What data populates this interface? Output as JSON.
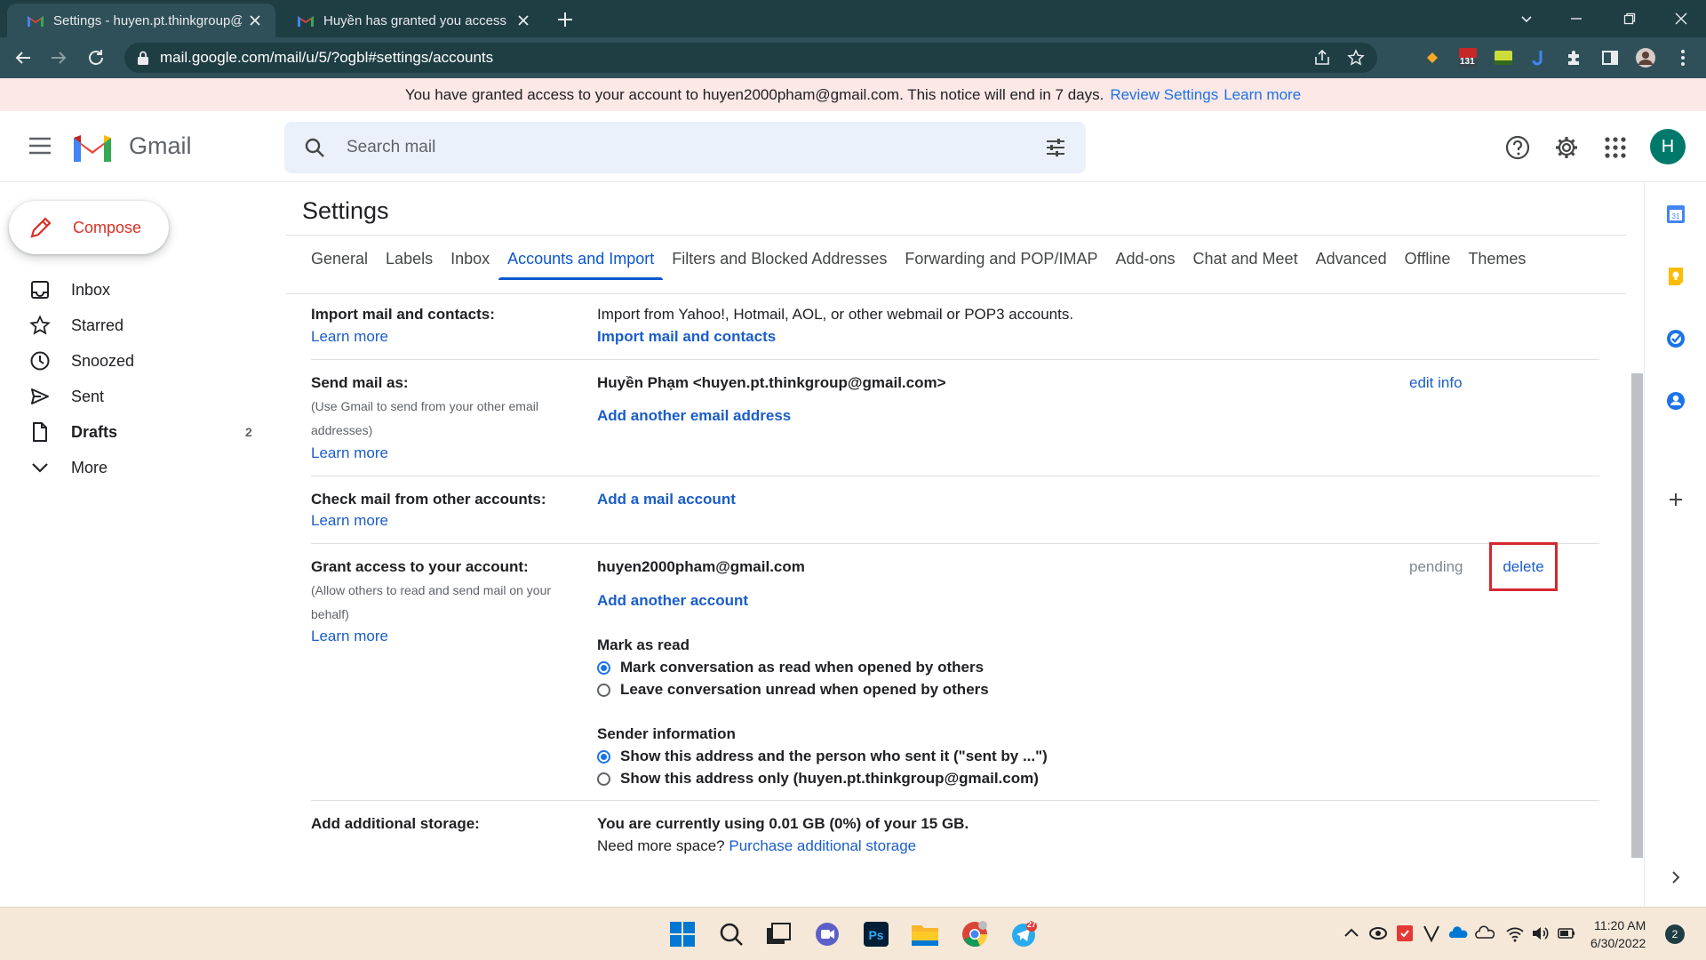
{
  "browser": {
    "tabs": [
      {
        "title": "Settings - huyen.pt.thinkgroup@gmail.com - Gmail"
      },
      {
        "title": "Huyền has granted you access to their account"
      }
    ],
    "url": "mail.google.com/mail/u/5/?ogbl#settings/accounts",
    "ext_badge": "131"
  },
  "notice": {
    "text": "You have granted access to your account to huyen2000pham@gmail.com. This notice will end in 7 days.",
    "review": "Review Settings",
    "learn": "Learn more"
  },
  "gmail": {
    "logo_text": "Gmail",
    "search_placeholder": "Search mail",
    "avatar": "H"
  },
  "nav": {
    "compose": "Compose",
    "items": [
      {
        "label": "Inbox",
        "count": ""
      },
      {
        "label": "Starred",
        "count": ""
      },
      {
        "label": "Snoozed",
        "count": ""
      },
      {
        "label": "Sent",
        "count": ""
      },
      {
        "label": "Drafts",
        "count": "2"
      },
      {
        "label": "More",
        "count": ""
      }
    ]
  },
  "settings": {
    "title": "Settings",
    "tabs": [
      "General",
      "Labels",
      "Inbox",
      "Accounts and Import",
      "Filters and Blocked Addresses",
      "Forwarding and POP/IMAP",
      "Add-ons",
      "Chat and Meet",
      "Advanced",
      "Offline",
      "Themes"
    ],
    "import": {
      "label": "Import mail and contacts:",
      "learn": "Learn more",
      "desc": "Import from Yahoo!, Hotmail, AOL, or other webmail or POP3 accounts.",
      "action": "Import mail and contacts"
    },
    "sendas": {
      "label": "Send mail as:",
      "sub": "(Use Gmail to send from your other email addresses)",
      "learn": "Learn more",
      "identity": "Huyền Phạm <huyen.pt.thinkgroup@gmail.com>",
      "add": "Add another email address",
      "edit": "edit info"
    },
    "check": {
      "label": "Check mail from other accounts:",
      "learn": "Learn more",
      "add": "Add a mail account"
    },
    "grant": {
      "label": "Grant access to your account:",
      "sub": "(Allow others to read and send mail on your behalf)",
      "learn": "Learn more",
      "account": "huyen2000pham@gmail.com",
      "add": "Add another account",
      "status": "pending",
      "delete": "delete",
      "markread_h": "Mark as read",
      "markread_opt1": "Mark conversation as read when opened by others",
      "markread_opt2": "Leave conversation unread when opened by others",
      "sender_h": "Sender information",
      "sender_opt1": "Show this address and the person who sent it (\"sent by ...\")",
      "sender_opt2": "Show this address only (huyen.pt.thinkgroup@gmail.com)"
    },
    "storage": {
      "label": "Add additional storage:",
      "usage": "You are currently using 0.01 GB (0%) of your 15 GB.",
      "need": "Need more space?",
      "purchase": "Purchase additional storage"
    }
  },
  "taskbar": {
    "time": "11:20 AM",
    "date": "6/30/2022",
    "notif_count": "2",
    "telegram_badge": "27"
  },
  "colors": {
    "chrome_dark": "#1f3e44",
    "chrome_light": "#2f5058",
    "accent": "#0b57d0",
    "link": "#1a5dc9",
    "notice_bg": "#fce8e6",
    "highlight": "#d3282f"
  }
}
